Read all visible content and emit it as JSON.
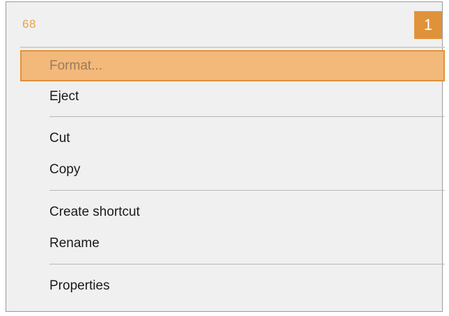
{
  "header": {
    "page_number": "68",
    "step_number": "1"
  },
  "context_menu": {
    "groups": [
      {
        "items": [
          {
            "label": "Format...",
            "highlighted": true
          },
          {
            "label": "Eject",
            "highlighted": false
          }
        ]
      },
      {
        "items": [
          {
            "label": "Cut",
            "highlighted": false
          },
          {
            "label": "Copy",
            "highlighted": false
          }
        ]
      },
      {
        "items": [
          {
            "label": "Create shortcut",
            "highlighted": false
          },
          {
            "label": "Rename",
            "highlighted": false
          }
        ]
      },
      {
        "items": [
          {
            "label": "Properties",
            "highlighted": false
          }
        ]
      }
    ]
  },
  "colors": {
    "accent": "#e0923a",
    "highlight_fill": "#f2b97a",
    "menu_background": "#f0f0f0"
  }
}
